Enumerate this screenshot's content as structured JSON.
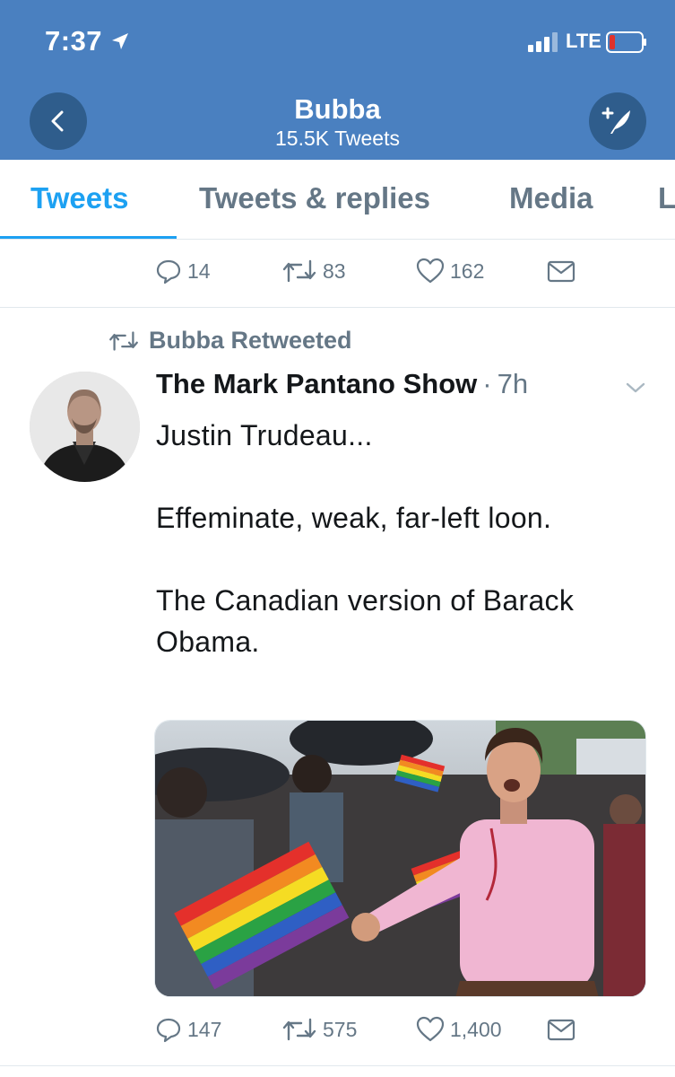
{
  "status_bar": {
    "time": "7:37",
    "network": "LTE"
  },
  "header": {
    "title": "Bubba",
    "subtitle": "15.5K Tweets"
  },
  "tabs": [
    {
      "label": "Tweets",
      "active": true
    },
    {
      "label": "Tweets & replies",
      "active": false
    },
    {
      "label": "Media",
      "active": false
    },
    {
      "label": "L",
      "active": false
    }
  ],
  "prev_tweet": {
    "replies": "14",
    "retweets": "83",
    "likes": "162"
  },
  "tweet": {
    "retweeted_by": "Bubba Retweeted",
    "author": "The Mark Pantano Show",
    "separator": "·",
    "time": "7h",
    "text": "Justin Trudeau...\n\nEffeminate, weak, far-left loon.\n\nThe Canadian version of Barack Obama.",
    "replies": "147",
    "retweets": "575",
    "likes": "1,400"
  },
  "colors": {
    "header_bg": "#4a80c0",
    "accent": "#1da1f2",
    "muted": "#657786"
  }
}
